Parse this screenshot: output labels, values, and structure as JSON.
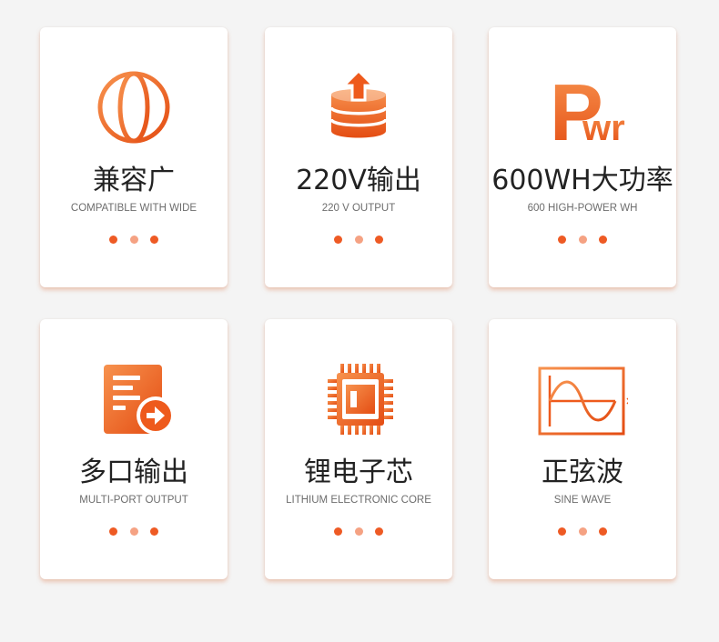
{
  "colors": {
    "accent": "#ee5a1c",
    "accent_light": "#f79a5c",
    "dot": "#ee5a24",
    "dot_light": "#f5a283"
  },
  "cards": [
    {
      "icon": "globe-icon",
      "title": "兼容广",
      "subtitle": "COMPATIBLE WITH WIDE"
    },
    {
      "icon": "database-upload-icon",
      "title": "220V输出",
      "subtitle": "220 V OUTPUT"
    },
    {
      "icon": "pwr-icon",
      "title": "600WH大功率",
      "subtitle": "600 HIGH-POWER WH",
      "icon_text_p": "P",
      "icon_text_wr": "wr"
    },
    {
      "icon": "document-arrow-icon",
      "title": "多口输出",
      "subtitle": "MULTI-PORT OUTPUT"
    },
    {
      "icon": "chip-icon",
      "title": "锂电子芯",
      "subtitle": "LITHIUM ELECTRONIC CORE"
    },
    {
      "icon": "sine-wave-icon",
      "title": "正弦波",
      "subtitle": "SINE WAVE"
    }
  ]
}
